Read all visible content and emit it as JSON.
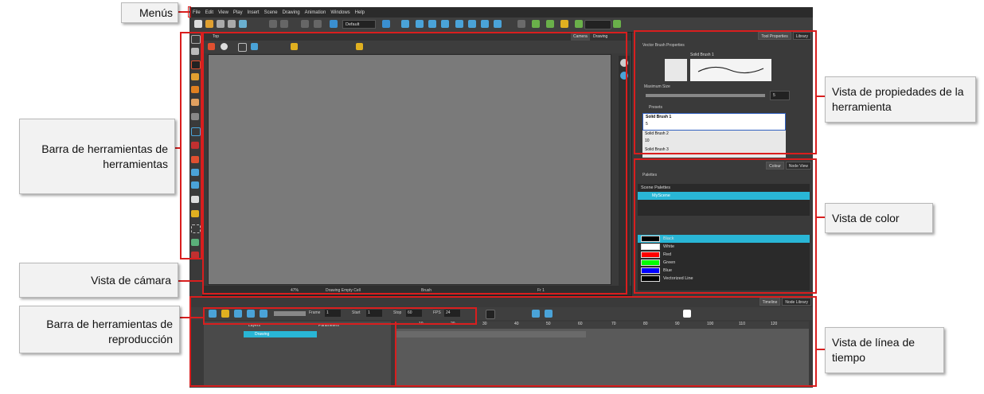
{
  "menubar": {
    "items": [
      "File",
      "Edit",
      "View",
      "Play",
      "Insert",
      "Scene",
      "Drawing",
      "Animation",
      "Windows",
      "Help"
    ]
  },
  "toolbar": {
    "preset_value": "Default"
  },
  "camera_view": {
    "tabs": [
      "Top",
      "Camera",
      "Drawing"
    ],
    "status": {
      "zoom": "47%",
      "drawing": "Drawing Empty Cell",
      "tool": "Brush",
      "frame": "Fr 1"
    }
  },
  "tool_properties": {
    "tabs": [
      "Tool Properties",
      "Library"
    ],
    "header": "Vector Brush Properties",
    "preset_name": "Solid Brush 1",
    "max_size_label": "Maximum Size",
    "max_size_value": "5",
    "presets_label": "Presets",
    "presets": [
      {
        "name": "Solid Brush 1",
        "size": "5"
      },
      {
        "name": "Solid Brush 2",
        "size": "10"
      },
      {
        "name": "Solid Brush 3",
        "size": ""
      }
    ]
  },
  "colour_view": {
    "tabs": [
      "Colour",
      "Node View"
    ],
    "palettes_label": "Palettes",
    "scene_palettes_label": "Scene Palettes",
    "selected_palette": "MyScene",
    "colours": [
      {
        "name": "Black",
        "swatch": "#000000"
      },
      {
        "name": "White",
        "swatch": "#ffffff"
      },
      {
        "name": "Red",
        "swatch": "#ff0000"
      },
      {
        "name": "Green",
        "swatch": "#00ff00"
      },
      {
        "name": "Blue",
        "swatch": "#0000ff"
      },
      {
        "name": "Vectorized Line",
        "swatch": "#000000"
      }
    ]
  },
  "timeline": {
    "tabs": [
      "Timeline",
      "Node Library"
    ],
    "frame_label": "Frame",
    "frame_value": "1",
    "start_label": "Start",
    "start_value": "1",
    "stop_label": "Stop",
    "stop_value": "60",
    "fps_label": "FPS",
    "fps_value": "24",
    "layers_header": "Layers",
    "params_header": "Parameters",
    "layer_name": "Drawing",
    "ruler": [
      "10",
      "20",
      "30",
      "40",
      "50",
      "60",
      "70",
      "80",
      "90",
      "100",
      "110",
      "120"
    ]
  },
  "callouts": {
    "menus": "Menús",
    "tools_toolbar": "Barra de herramientas de herramientas",
    "camera_view": "Vista de cámara",
    "playback_toolbar": "Barra de herramientas de reproducción",
    "tool_properties_view": "Vista de propiedades de la herramienta",
    "colour_view": "Vista de color",
    "timeline_view": "Vista de línea de tiempo"
  },
  "colors": {
    "highlight": "#d91e1e",
    "selection_cyan": "#29b6d6",
    "canvas": "#7a7a7a",
    "panel": "#3a3a3a"
  }
}
